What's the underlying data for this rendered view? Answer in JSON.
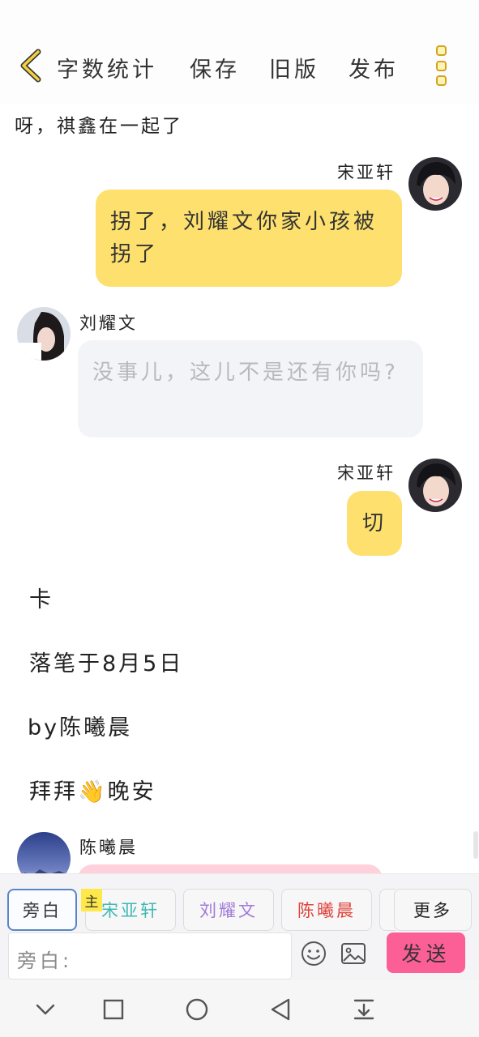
{
  "header": {
    "word_count": "字数统计",
    "save": "保存",
    "old_version": "旧版",
    "publish": "发布"
  },
  "previous_line": "呀，祺鑫在一起了",
  "messages": [
    {
      "speaker": "宋亚轩",
      "side": "right",
      "text": "拐了，刘耀文你家小孩被拐了",
      "bubble_color": "#fde06e"
    },
    {
      "speaker": "刘耀文",
      "side": "left",
      "text": "没事儿，这儿不是还有你吗?",
      "bubble_color": "#f3f4f8"
    },
    {
      "speaker": "宋亚轩",
      "side": "right",
      "text": "切",
      "bubble_color": "#fde06e"
    }
  ],
  "narration": [
    "卡",
    "落笔于8月5日",
    "by陈曦晨",
    "拜拜👋晚安"
  ],
  "last_message": {
    "speaker": "陈曦晨",
    "bubble_color": "#ffd1dc"
  },
  "roles": {
    "narrator": "旁白",
    "main_tag": "主",
    "items": [
      {
        "name": "宋亚轩",
        "color": "#3fb8b3"
      },
      {
        "name": "刘耀文",
        "color": "#a07ad6"
      },
      {
        "name": "陈曦晨",
        "color": "#e0443c"
      }
    ],
    "more": "更多"
  },
  "input": {
    "placeholder": "旁白:"
  },
  "send_label": "发送",
  "colors": {
    "accent_yellow": "#fde06e",
    "send_pink": "#fb5f95",
    "active_border": "#5b86c4"
  }
}
